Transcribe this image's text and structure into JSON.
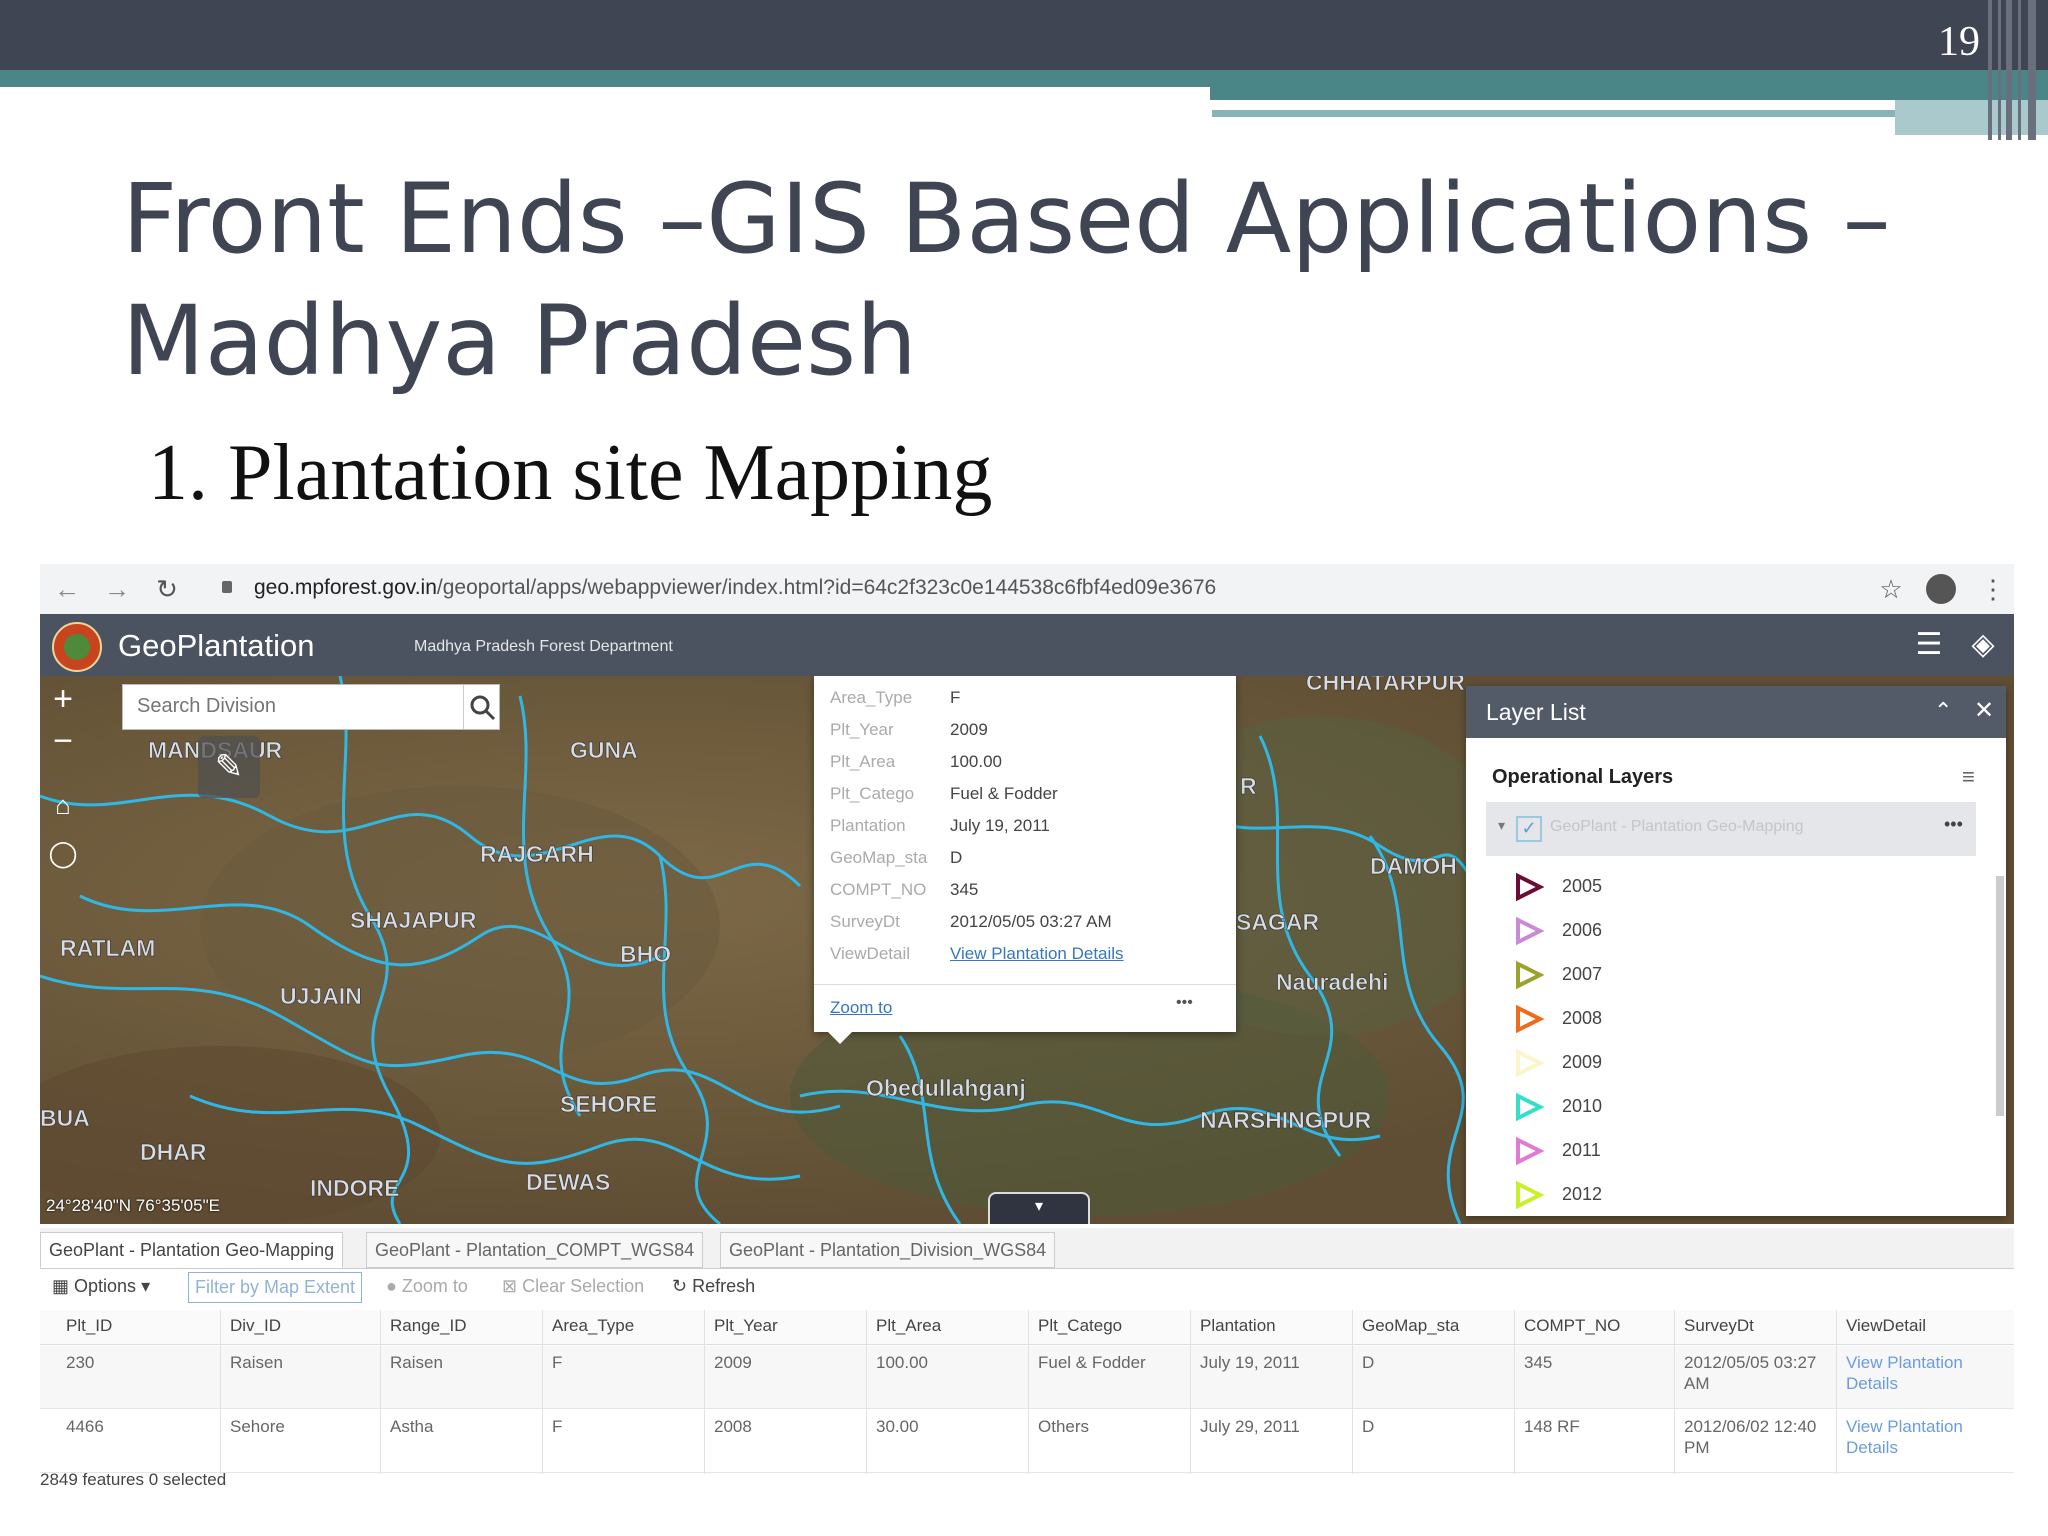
{
  "slide": {
    "page_number": "19",
    "title_line1": "Front Ends –GIS Based Applications –",
    "title_line2": "Madhya Pradesh",
    "subtitle": "1. Plantation site Mapping"
  },
  "browser": {
    "url_host": "geo.mpforest.gov.in",
    "url_path": "/geoportal/apps/webappviewer/index.html?id=64c2f323c0e144538c6fbf4ed09e3676"
  },
  "app": {
    "title": "GeoPlantation",
    "subtitle": "Madhya Pradesh Forest Department"
  },
  "map": {
    "search_placeholder": "Search Division",
    "coordinates": "24°28'40\"N 76°35'05\"E",
    "regions": [
      "MANDSAUR",
      "GUNA",
      "RAJGARH",
      "SHAJAPUR",
      "RATLAM",
      "UJJAIN",
      "SEHORE",
      "Obedullahganj",
      "BUA",
      "DHAR",
      "INDORE",
      "DEWAS",
      "CHHATARPUR",
      "DAMOH",
      "SAGAR",
      "Nauradehi",
      "NARSHINGPUR",
      "BHO",
      "R"
    ]
  },
  "popup": {
    "rows": [
      {
        "key": "Area_Type",
        "value": "F"
      },
      {
        "key": "Plt_Year",
        "value": "2009"
      },
      {
        "key": "Plt_Area",
        "value": "100.00"
      },
      {
        "key": "Plt_Catego",
        "value": "Fuel & Fodder"
      },
      {
        "key": "Plantation",
        "value": "July 19, 2011"
      },
      {
        "key": "GeoMap_sta",
        "value": "D"
      },
      {
        "key": "COMPT_NO",
        "value": "345"
      },
      {
        "key": "SurveyDt",
        "value": "2012/05/05 03:27 AM"
      },
      {
        "key": "ViewDetail",
        "value": "View Plantation Details"
      }
    ],
    "zoom_to": "Zoom to",
    "more": "•••"
  },
  "layer_list": {
    "title": "Layer List",
    "operational_layers": "Operational Layers",
    "layer_name": "GeoPlant - Plantation Geo-Mapping",
    "legend": [
      {
        "label": "2005",
        "color": "#6a0d36"
      },
      {
        "label": "2006",
        "color": "#c98ad6"
      },
      {
        "label": "2007",
        "color": "#9aa32b"
      },
      {
        "label": "2008",
        "color": "#f06a1d"
      },
      {
        "label": "2009",
        "color": "#fbf6c9"
      },
      {
        "label": "2010",
        "color": "#33e0c6"
      },
      {
        "label": "2011",
        "color": "#e07ad8"
      },
      {
        "label": "2012",
        "color": "#c8f02a"
      }
    ]
  },
  "attribute_table": {
    "tabs": [
      "GeoPlant - Plantation Geo-Mapping",
      "GeoPlant - Plantation_COMPT_WGS84",
      "GeoPlant - Plantation_Division_WGS84"
    ],
    "toolbar": {
      "options": "Options",
      "filter": "Filter by Map Extent",
      "zoom": "Zoom to",
      "clear": "Clear Selection",
      "refresh": "Refresh"
    },
    "columns": [
      "Plt_ID",
      "Div_ID",
      "Range_ID",
      "Area_Type",
      "Plt_Year",
      "Plt_Area",
      "Plt_Catego",
      "Plantation",
      "GeoMap_sta",
      "COMPT_NO",
      "SurveyDt",
      "ViewDetail"
    ],
    "rows": [
      [
        "230",
        "Raisen",
        "Raisen",
        "F",
        "2009",
        "100.00",
        "Fuel & Fodder",
        "July 19, 2011",
        "D",
        "345",
        "2012/05/05 03:27 AM",
        "View Plantation Details"
      ],
      [
        "4466",
        "Sehore",
        "Astha",
        "F",
        "2008",
        "30.00",
        "Others",
        "July 29, 2011",
        "D",
        "148 RF",
        "2012/06/02 12:40 PM",
        "View Plantation Details"
      ]
    ],
    "footer": "2849 features 0 selected"
  }
}
